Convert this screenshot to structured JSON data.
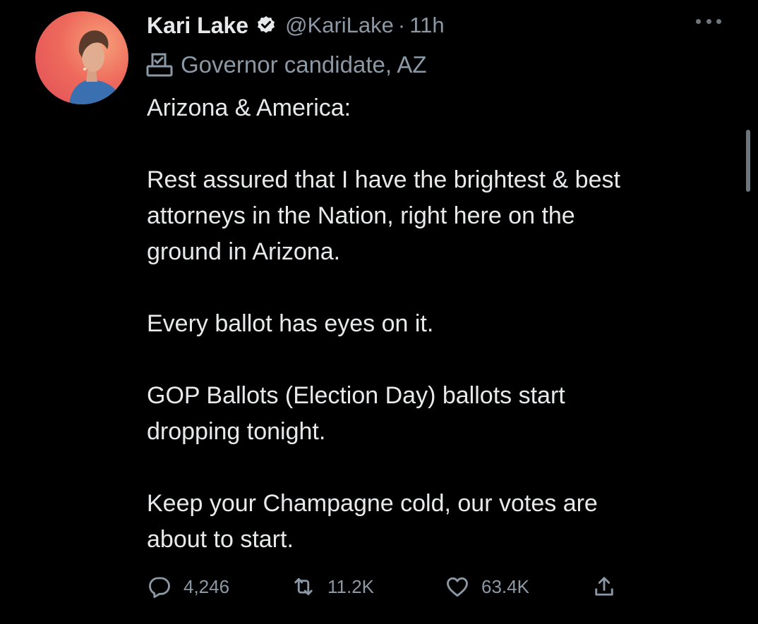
{
  "tweet": {
    "author": {
      "name": "Kari Lake",
      "handle": "@KariLake",
      "separator": "·",
      "time": "11h",
      "verified": true
    },
    "label": {
      "icon": "ballot-box-icon",
      "text": "Governor candidate, AZ"
    },
    "body": {
      "p1": "Arizona & America:",
      "p2_l1": "Rest assured that I have the brightest & best",
      "p2_l2": "attorneys in the Nation, right here on the",
      "p2_l3": "ground in Arizona.",
      "p3": "Every ballot has eyes on it.",
      "p4_l1": "GOP Ballots (Election Day) ballots start",
      "p4_l2": "dropping tonight.",
      "p5_l1": "Keep your Champagne cold, our votes are",
      "p5_l2": "about to start."
    },
    "actions": {
      "replies": "4,246",
      "retweets": "11.2K",
      "likes": "63.4K"
    }
  },
  "colors": {
    "background": "#000000",
    "text": "#e7e9ea",
    "secondary": "#8b98a5"
  }
}
